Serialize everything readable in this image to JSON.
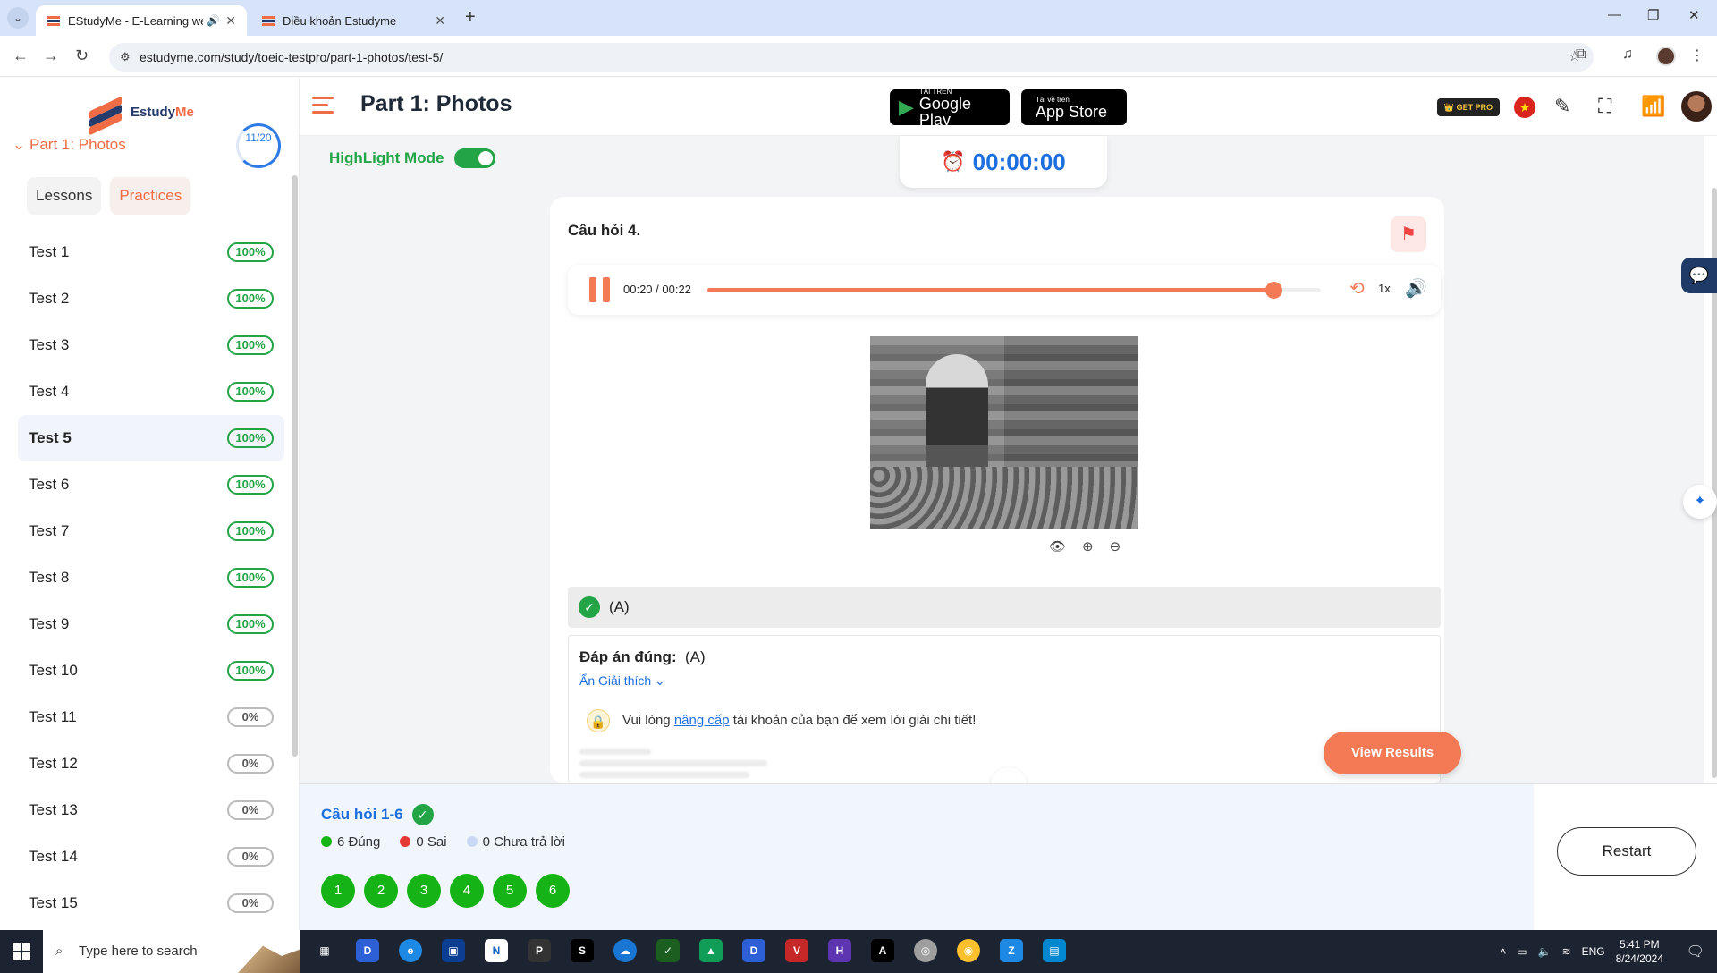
{
  "browser": {
    "tabs": [
      {
        "title": "EStudyMe - E-Learning web",
        "active": true
      },
      {
        "title": "Điều khoản Estudyme",
        "active": false
      }
    ],
    "url": "estudyme.com/study/toeic-testpro/part-1-photos/test-5/"
  },
  "sidebar": {
    "logo_primary": "Estudy",
    "logo_accent": "Me",
    "section_label": "Part 1: Photos",
    "section_progress": "11/20",
    "tabs": {
      "lessons": "Lessons",
      "practices": "Practices"
    },
    "tests": [
      {
        "name": "Test 1",
        "score": "100%",
        "complete": true
      },
      {
        "name": "Test 2",
        "score": "100%",
        "complete": true
      },
      {
        "name": "Test 3",
        "score": "100%",
        "complete": true
      },
      {
        "name": "Test 4",
        "score": "100%",
        "complete": true
      },
      {
        "name": "Test 5",
        "score": "100%",
        "complete": true,
        "current": true
      },
      {
        "name": "Test 6",
        "score": "100%",
        "complete": true
      },
      {
        "name": "Test 7",
        "score": "100%",
        "complete": true
      },
      {
        "name": "Test 8",
        "score": "100%",
        "complete": true
      },
      {
        "name": "Test 9",
        "score": "100%",
        "complete": true
      },
      {
        "name": "Test 10",
        "score": "100%",
        "complete": true
      },
      {
        "name": "Test 11",
        "score": "0%",
        "complete": false
      },
      {
        "name": "Test 12",
        "score": "0%",
        "complete": false
      },
      {
        "name": "Test 13",
        "score": "0%",
        "complete": false
      },
      {
        "name": "Test 14",
        "score": "0%",
        "complete": false
      },
      {
        "name": "Test 15",
        "score": "0%",
        "complete": false
      }
    ]
  },
  "header": {
    "title": "Part 1: Photos",
    "google_play_small": "TẢI TRÊN",
    "google_play_big": "Google Play",
    "app_store_small": "Tải về trên",
    "app_store_big": "App Store",
    "get_pro": "GET PRO"
  },
  "main": {
    "highlight_mode_label": "HighLight Mode",
    "highlight_mode_on": true,
    "timer": "00:00:00",
    "question_title": "Câu hỏi 4.",
    "audio": {
      "time": "00:20 / 00:22",
      "progress": 0.923,
      "speed": "1x"
    },
    "choice_label": "(A)",
    "correct_answer_label": "Đáp án đúng:",
    "correct_answer_value": "(A)",
    "hide_explanation": "Ẩn Giải thích",
    "upgrade_prefix": "Vui lòng ",
    "upgrade_link": "nâng cấp",
    "upgrade_suffix": " tài khoản của bạn để xem lời giải chi tiết!",
    "view_results": "View Results"
  },
  "summary": {
    "range_label": "Câu hỏi 1-6",
    "correct": "6 Đúng",
    "wrong": "0 Sai",
    "unanswered": "0 Chưa trả lời",
    "questions": [
      "1",
      "2",
      "3",
      "4",
      "5",
      "6"
    ],
    "restart": "Restart",
    "colors": {
      "correct": "#16b316",
      "wrong": "#e53935",
      "unanswered": "#c9d9f5"
    }
  },
  "taskbar": {
    "search_placeholder": "Type here to search",
    "language": "ENG",
    "time": "5:41 PM",
    "date": "8/24/2024"
  }
}
